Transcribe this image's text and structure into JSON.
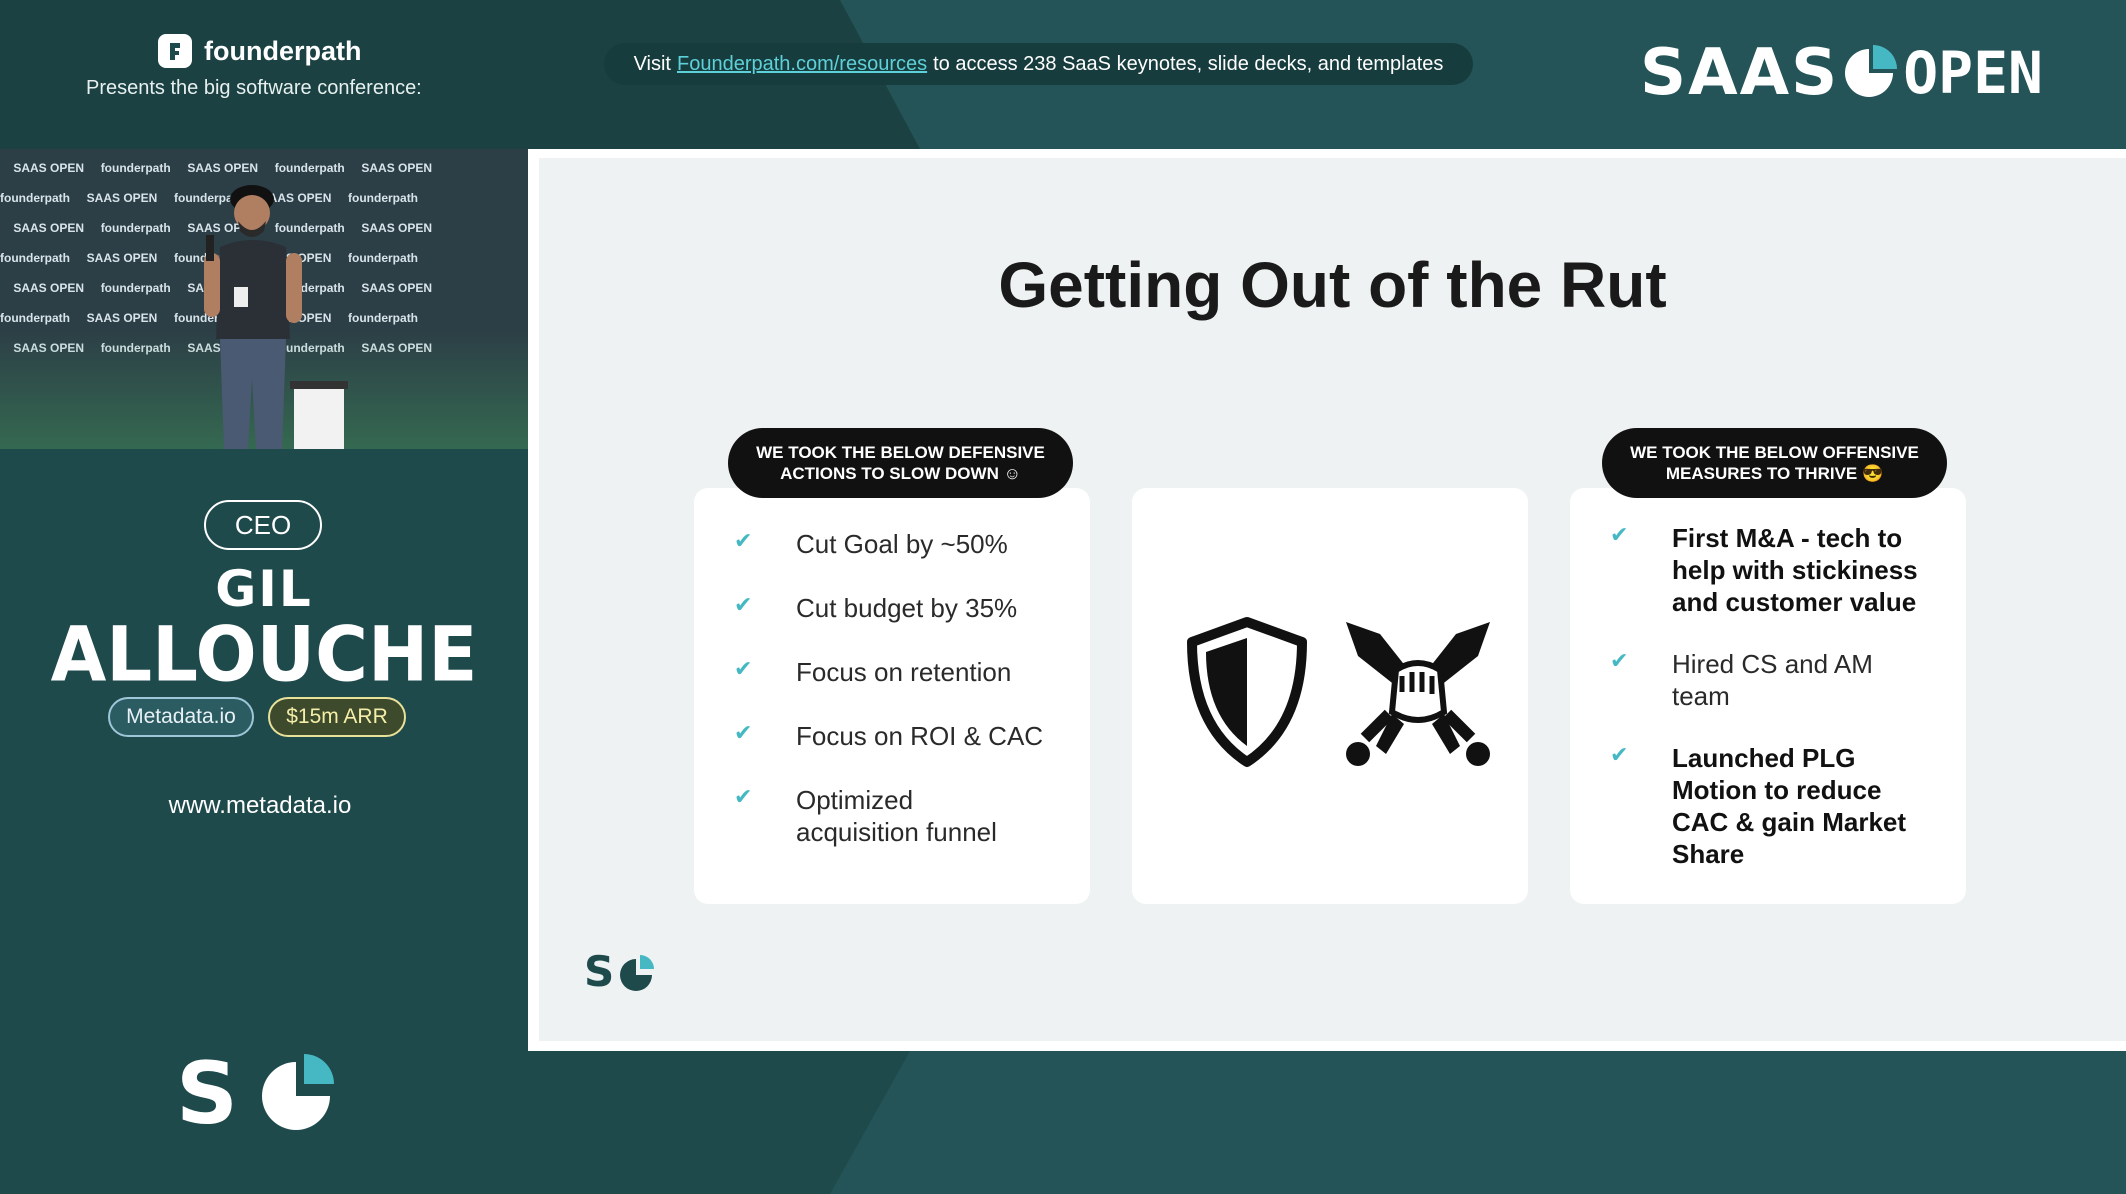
{
  "header": {
    "brand_name": "founderpath",
    "brand_subtitle": "Presents the big software conference:",
    "banner_prefix": "Visit",
    "banner_link": "Founderpath.com/resources",
    "banner_suffix": "to access 238 SaaS keynotes, slide decks, and templates",
    "event_logo_word1": "SAAS",
    "event_logo_word2": "OPEN"
  },
  "video": {
    "backdrop_saas": "SAAS OPEN",
    "backdrop_fp": "founderpath"
  },
  "speaker": {
    "role": "CEO",
    "first_name": "GIL",
    "last_name": "ALLOUCHE",
    "company": "Metadata.io",
    "arr": "$15m ARR",
    "website": "www.metadata.io",
    "logo_text": "S"
  },
  "slide": {
    "title": "Getting Out of the Rut",
    "defensive_pill": "WE TOOK THE BELOW DEFENSIVE ACTIONS TO SLOW DOWN ☺",
    "offensive_pill": "WE TOOK THE BELOW OFFENSIVE MEASURES TO THRIVE 😎",
    "defensive_items": [
      "Cut Goal by ~50%",
      "Cut budget by 35%",
      "Focus on retention",
      "Focus on ROI & CAC",
      "Optimized acquisition funnel"
    ],
    "offensive_items": [
      "First M&A - tech to help with stickiness and customer value",
      "Hired CS and AM team",
      "Launched PLG Motion to reduce CAC & gain Market Share"
    ],
    "icons": [
      "shield-icon",
      "crossed-swords-fist-icon"
    ],
    "logo_text": "S"
  },
  "colors": {
    "background": "#1f4a4c",
    "accent": "#46b8c4",
    "link": "#5ed0d8"
  }
}
